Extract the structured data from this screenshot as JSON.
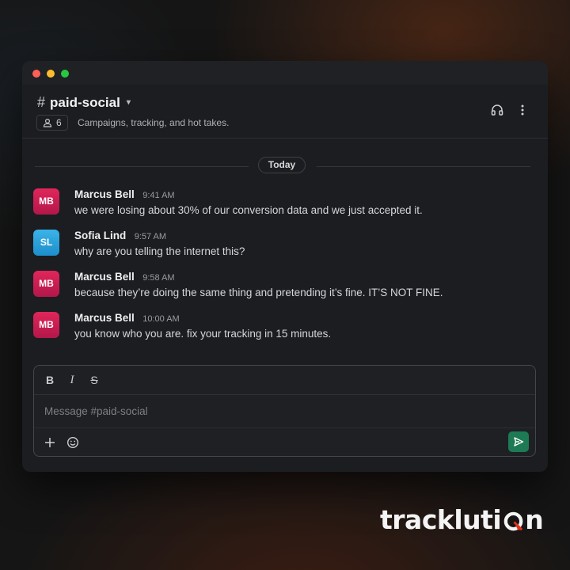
{
  "window": {
    "controls": [
      "close",
      "minimize",
      "zoom"
    ]
  },
  "channel": {
    "hash": "#",
    "name": "paid-social",
    "member_count": "6",
    "topic": "Campaigns, tracking, and hot takes."
  },
  "header_icons": [
    "headphones-icon",
    "more-vertical-icon"
  ],
  "date_divider": "Today",
  "messages": [
    {
      "avatar": "MB",
      "author": "Marcus Bell",
      "time": "9:41 AM",
      "text": "we were losing about 30% of our conversion data and we just accepted it."
    },
    {
      "avatar": "SL",
      "author": "Sofia Lind",
      "time": "9:57 AM",
      "text": "why are you telling the internet this?"
    },
    {
      "avatar": "MB",
      "author": "Marcus Bell",
      "time": "9:58 AM",
      "text": "because they’re doing the same thing and pretending it’s fine. IT’S NOT FINE."
    },
    {
      "avatar": "MB",
      "author": "Marcus Bell",
      "time": "10:00 AM",
      "text": "you know who you are. fix your tracking in 15 minutes."
    }
  ],
  "composer": {
    "format_buttons": {
      "bold": "B",
      "italic": "I",
      "strike": "S"
    },
    "placeholder": "Message #paid-social",
    "value": ""
  },
  "colors": {
    "accent_red_avatar": "#d61f55",
    "accent_blue_avatar": "#2ea5e0",
    "send_green": "#1d7a55"
  },
  "brand": {
    "logo_text_before": "trackluti",
    "logo_text_after": "n"
  }
}
